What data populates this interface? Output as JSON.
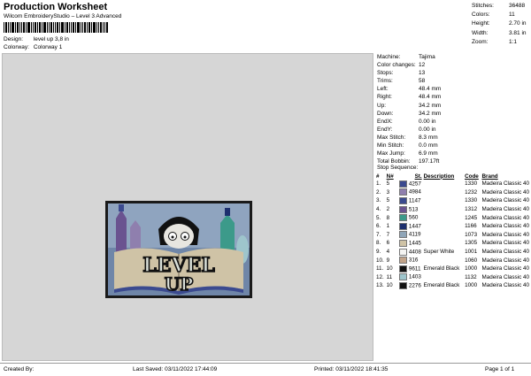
{
  "header": {
    "title": "Production Worksheet",
    "subtitle": "Wilcom EmbroideryStudio – Level 3 Advanced",
    "design_label": "Design:",
    "design_value": "level up 3,8 in",
    "colorway_label": "Colorway:",
    "colorway_value": "Colorway 1"
  },
  "summary": [
    {
      "label": "Stitches:",
      "value": "36488"
    },
    {
      "label": "Colors:",
      "value": "11"
    },
    {
      "label": "Height:",
      "value": "2.70 in"
    },
    {
      "label": "Width:",
      "value": "3.81 in"
    },
    {
      "label": "Zoom:",
      "value": "1:1"
    }
  ],
  "design_text": [
    "LEVEL",
    "UP"
  ],
  "machine_info": [
    {
      "label": "Machine:",
      "value": "Tajima"
    },
    {
      "label": "Color changes:",
      "value": "12"
    },
    {
      "label": "Stops:",
      "value": "13"
    },
    {
      "label": "Trims:",
      "value": "58"
    },
    {
      "label": "Left:",
      "value": "48.4 mm"
    },
    {
      "label": "Right:",
      "value": "48.4 mm"
    },
    {
      "label": "Up:",
      "value": "34.2 mm"
    },
    {
      "label": "Down:",
      "value": "34.2 mm"
    },
    {
      "label": "EndX:",
      "value": "0.00 in"
    },
    {
      "label": "EndY:",
      "value": "0.00 in"
    },
    {
      "label": "Max Stitch:",
      "value": "8.3 mm"
    },
    {
      "label": "Min Stitch:",
      "value": "0.0 mm"
    },
    {
      "label": "Max Jump:",
      "value": "6.9 mm"
    },
    {
      "label": "Total Bobbin:",
      "value": "197.17ft"
    }
  ],
  "stop_sequence": {
    "title": "Stop Sequence:",
    "headers": [
      "#",
      "N#",
      "St.",
      "Description",
      "Code",
      "Brand"
    ],
    "rows": [
      {
        "n": "1.",
        "needle": "5",
        "color": "#3b4a8f",
        "st": "4257",
        "desc": "",
        "code": "1330",
        "brand": "Madeira Classic 40"
      },
      {
        "n": "2.",
        "needle": "3",
        "color": "#8f7fae",
        "st": "4984",
        "desc": "",
        "code": "1232",
        "brand": "Madeira Classic 40"
      },
      {
        "n": "3.",
        "needle": "5",
        "color": "#3b4a8f",
        "st": "1147",
        "desc": "",
        "code": "1330",
        "brand": "Madeira Classic 40"
      },
      {
        "n": "4.",
        "needle": "2",
        "color": "#6a5390",
        "st": "513",
        "desc": "",
        "code": "1312",
        "brand": "Madeira Classic 40"
      },
      {
        "n": "5.",
        "needle": "8",
        "color": "#3c9a8a",
        "st": "560",
        "desc": "",
        "code": "1245",
        "brand": "Madeira Classic 40"
      },
      {
        "n": "6.",
        "needle": "1",
        "color": "#1d2f6e",
        "st": "1447",
        "desc": "",
        "code": "1166",
        "brand": "Madeira Classic 40"
      },
      {
        "n": "7.",
        "needle": "7",
        "color": "#8fa5b8",
        "st": "4119",
        "desc": "",
        "code": "1073",
        "brand": "Madeira Classic 40"
      },
      {
        "n": "8.",
        "needle": "6",
        "color": "#cfc3a6",
        "st": "1445",
        "desc": "",
        "code": "1305",
        "brand": "Madeira Classic 40"
      },
      {
        "n": "9.",
        "needle": "4",
        "color": "#f4f4f2",
        "st": "4408",
        "desc": "Super White",
        "code": "1001",
        "brand": "Madeira Classic 40"
      },
      {
        "n": "10.",
        "needle": "9",
        "color": "#c2a48a",
        "st": "316",
        "desc": "",
        "code": "1060",
        "brand": "Madeira Classic 40"
      },
      {
        "n": "11.",
        "needle": "10",
        "color": "#111111",
        "st": "9611",
        "desc": "Emerald Black",
        "code": "1000",
        "brand": "Madeira Classic 40"
      },
      {
        "n": "12.",
        "needle": "11",
        "color": "#9ec5cc",
        "st": "1403",
        "desc": "",
        "code": "1132",
        "brand": "Madeira Classic 40"
      },
      {
        "n": "13.",
        "needle": "10",
        "color": "#111111",
        "st": "2276",
        "desc": "Emerald Black",
        "code": "1000",
        "brand": "Madeira Classic 40"
      }
    ]
  },
  "footer": {
    "created_by": "Created By:",
    "last_saved": "Last Saved: 03/11/2022 17:44:09",
    "printed": "Printed: 03/11/2022 18:41:35",
    "page": "Page 1 of 1"
  }
}
